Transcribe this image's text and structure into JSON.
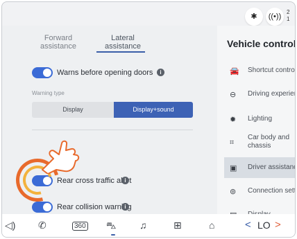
{
  "status": {
    "bluetooth_icon": "bluetooth-icon",
    "signal_icon": "signal-icon",
    "time_line1": "2",
    "time_line2": "1"
  },
  "tabs": [
    {
      "label": "Forward\nassistance"
    },
    {
      "label": "Lateral\nassistance",
      "active": true
    }
  ],
  "settings": {
    "warn_doors": "Warns before opening doors",
    "warning_type_label": "Warning type",
    "warning_options": [
      "Display",
      "Display+sound"
    ],
    "warning_selected": "Display+sound",
    "rear_cross": "Rear cross traffic alert",
    "rear_collision": "Rear collision warning"
  },
  "vehicle_control": {
    "title": "Vehicle control",
    "items": [
      {
        "label": "Shortcut control",
        "icon": "car-icon"
      },
      {
        "label": "Driving experience",
        "icon": "steering-wheel-icon"
      },
      {
        "label": "Lighting",
        "icon": "light-icon"
      },
      {
        "label": "Car body and\nchassis",
        "icon": "chassis-icon"
      },
      {
        "label": "Driver assistance",
        "icon": "driver-assist-icon",
        "active": true
      },
      {
        "label": "Connection setting",
        "icon": "connection-icon"
      },
      {
        "label": "Display",
        "icon": "display-icon"
      }
    ]
  },
  "dock": {
    "left_icon": "volume-icon",
    "phone": "phone-icon",
    "camera": "360-camera-icon",
    "car": "car-icon",
    "music": "music-icon",
    "apps": "apps-grid-icon",
    "home": "home-icon",
    "temp": "LO",
    "temp_prev": "<",
    "temp_next": ">"
  },
  "colors": {
    "accent": "#3d62b5",
    "toggle_on": "#3b6bd6",
    "tap_outer": "#e86a2c",
    "tap_inner": "#f3b23d"
  }
}
